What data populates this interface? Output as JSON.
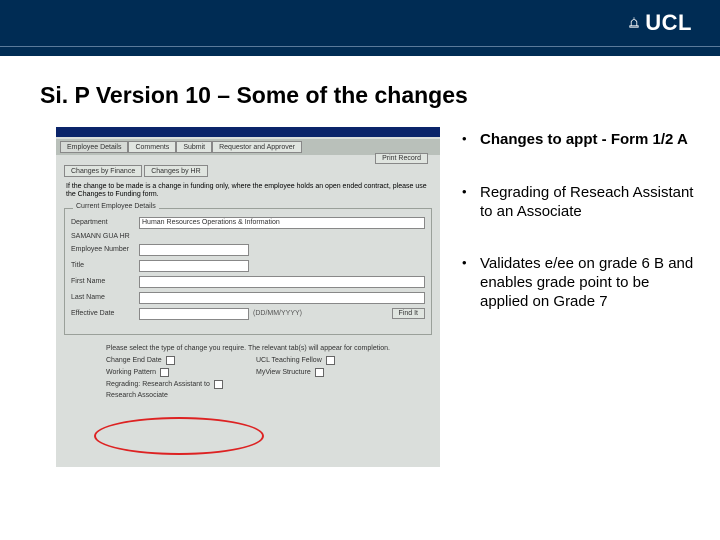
{
  "header": {
    "logo_text": "UCL"
  },
  "title": "Si. P Version 10 – Some of the changes",
  "form": {
    "tabs": [
      "Employee Details",
      "Comments",
      "Submit",
      "Requestor and Approver"
    ],
    "print_btn": "Print Record",
    "sub_tabs": [
      "Changes by Finance",
      "Changes by HR"
    ],
    "note": "If the change to be made is a change in funding only, where the employee holds an open ended contract, please use the Changes to Funding form.",
    "fieldset_legend": "Current Employee Details",
    "fields": {
      "dept": {
        "label": "Department",
        "value": "Human Resources Operations & Information"
      },
      "upi": {
        "label": "SAMANN GUA HR",
        "value": ""
      },
      "empno": {
        "label": "Employee Number",
        "value": ""
      },
      "title": {
        "label": "Title",
        "value": ""
      },
      "first": {
        "label": "First Name",
        "value": ""
      },
      "last": {
        "label": "Last Name",
        "value": ""
      },
      "eff": {
        "label": "Effective Date",
        "value": "",
        "hint": "(DD/MM/YYYY)"
      }
    },
    "find_btn": "Find It",
    "prompt": "Please select the type of change you require. The relevant tab(s) will appear for completion.",
    "checks": {
      "c1": "Change End Date",
      "c2": "UCL Teaching Fellow",
      "c3": "Working Pattern",
      "c4": "MyView Structure",
      "c5": "Regrading: Research Assistant to",
      "c6": "Research Associate"
    }
  },
  "bullets": {
    "b1": "Changes to appt - Form 1/2 A",
    "b2": "Regrading of Reseach Assistant to an Associate",
    "b3": "Validates e/ee on grade 6 B and enables grade point to be applied on Grade 7"
  }
}
